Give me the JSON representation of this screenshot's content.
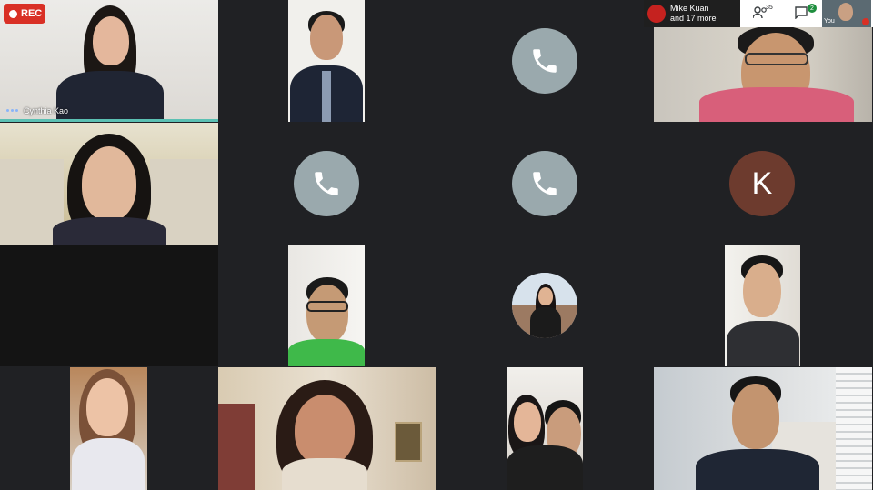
{
  "recording": {
    "label": "REC"
  },
  "speaker": {
    "name": "Cynthia Kao"
  },
  "participants_bar": {
    "name": "Mike Kuan",
    "more": "and 17 more",
    "people_count": "35",
    "chat_count": "2",
    "self_label": "You"
  },
  "avatar_initial": "K",
  "colors": {
    "background": "#202124",
    "active_speaker": "#5bc0b3",
    "rec": "#d93025",
    "phone_tile": "#9aa9ad",
    "avatar_k": "#6d3b2e"
  }
}
